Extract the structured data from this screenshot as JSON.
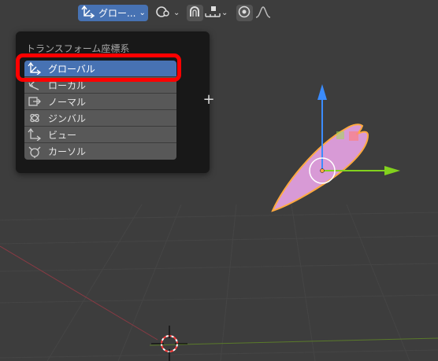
{
  "toolbar": {
    "orientation_label": "グロー...",
    "orientation_icon": "transform-orientation-icon",
    "pivot_icon": "pivot-point-icon",
    "snap_icon": "snap-magnet-icon",
    "snap_increment_icon": "snap-increment-icon",
    "proportional_icon": "proportional-editing-icon",
    "falloff_icon": "falloff-curve-icon"
  },
  "popup": {
    "title": "トランスフォーム座標系",
    "add_label": "+",
    "items": [
      {
        "label": "グローバル",
        "icon": "global-axis-icon",
        "selected": true
      },
      {
        "label": "ローカル",
        "icon": "local-axis-icon",
        "selected": false
      },
      {
        "label": "ノーマル",
        "icon": "normal-axis-icon",
        "selected": false
      },
      {
        "label": "ジンバル",
        "icon": "gimbal-icon",
        "selected": false
      },
      {
        "label": "ビュー",
        "icon": "view-axis-icon",
        "selected": false
      },
      {
        "label": "カーソル",
        "icon": "cursor-axis-icon",
        "selected": false
      }
    ]
  },
  "colors": {
    "accent": "#4772b3",
    "highlight_box": "#ff0000",
    "viewport_bg": "#3d3d3d",
    "object_fill": "#d89ad6",
    "object_outline": "#ffaa40",
    "gizmo_x": "#fd3b58",
    "gizmo_y": "#82d11d",
    "gizmo_z": "#3b8cfd"
  }
}
